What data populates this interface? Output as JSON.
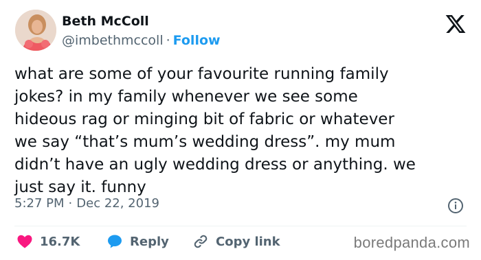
{
  "author": {
    "name": "Beth McColl",
    "handle": "@imbethmccoll",
    "separator": "·",
    "follow_label": "Follow"
  },
  "tweet": {
    "text": "what are some of your favourite running family\njokes? in my family whenever we see some\nhideous rag or minging bit of fabric or whatever\nwe say “that’s mum’s wedding dress”. my mum\ndidn’t have an ugly wedding dress or anything. we\njust say it. funny"
  },
  "meta": {
    "time": "5:27 PM",
    "separator": "·",
    "date": "Dec 22, 2019"
  },
  "actions": {
    "likes": "16.7K",
    "reply_label": "Reply",
    "copy_link_label": "Copy link"
  },
  "watermark": "boredpanda.com",
  "icons": {
    "logo": "x-logo-icon",
    "info": "info-icon",
    "like": "heart-icon",
    "reply": "speech-bubble-icon",
    "copy": "link-icon"
  },
  "colors": {
    "accent": "#1d9bf0",
    "like": "#f91880",
    "text": "#0f1419",
    "muted": "#536471"
  }
}
